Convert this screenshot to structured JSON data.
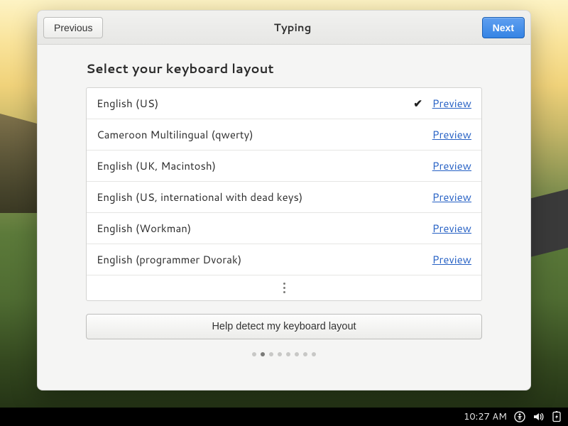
{
  "header": {
    "previous_label": "Previous",
    "title": "Typing",
    "next_label": "Next"
  },
  "main": {
    "heading": "Select your keyboard layout",
    "layouts": [
      {
        "name": "English (US)",
        "selected": true,
        "preview_label": "Preview"
      },
      {
        "name": "Cameroon Multilingual (qwerty)",
        "selected": false,
        "preview_label": "Preview"
      },
      {
        "name": "English (UK, Macintosh)",
        "selected": false,
        "preview_label": "Preview"
      },
      {
        "name": "English (US, international with dead keys)",
        "selected": false,
        "preview_label": "Preview"
      },
      {
        "name": "English (Workman)",
        "selected": false,
        "preview_label": "Preview"
      },
      {
        "name": "English (programmer Dvorak)",
        "selected": false,
        "preview_label": "Preview"
      }
    ],
    "detect_label": "Help detect my keyboard layout",
    "pager": {
      "total": 8,
      "active_index": 1
    }
  },
  "taskbar": {
    "clock": "10:27 AM"
  }
}
